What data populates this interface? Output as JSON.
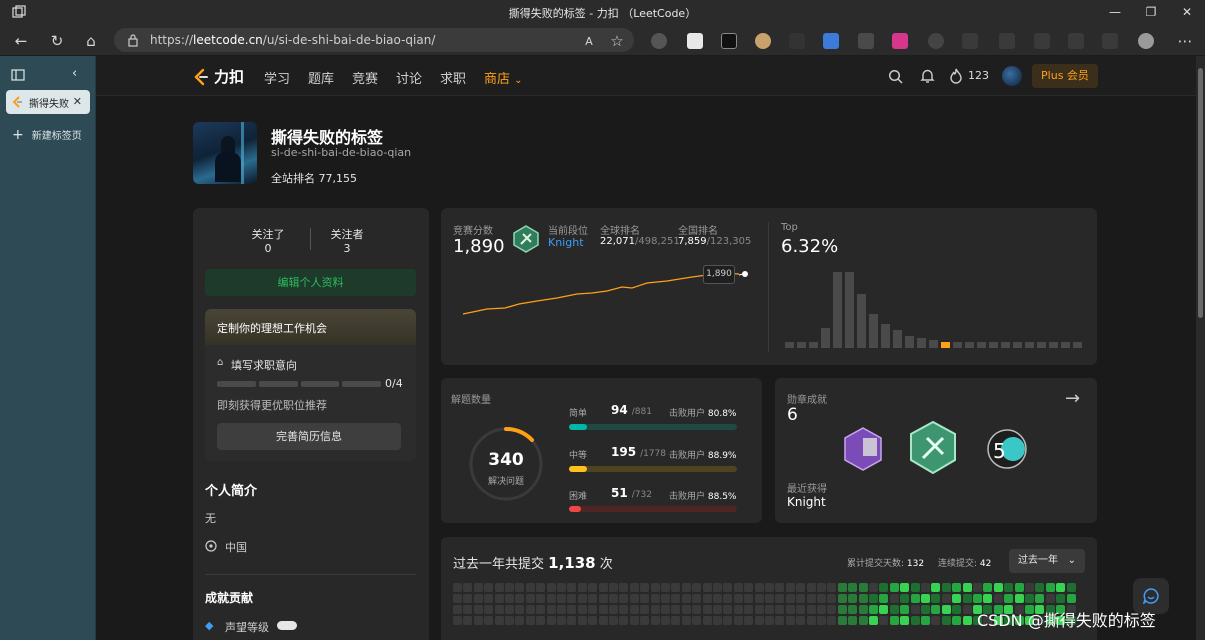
{
  "window": {
    "title": "撕得失败的标签 - 力扣 （LeetCode）",
    "url_scheme": "https://",
    "url_host": "leetcode.cn",
    "url_path": "/u/si-de-shi-bai-de-biao-qian/"
  },
  "sidebar": {
    "tab_label": "撕得失败",
    "new_tab_label": "新建标签页"
  },
  "nav": {
    "logo_text": "力扣",
    "items": [
      "学习",
      "题库",
      "竞赛",
      "讨论",
      "求职"
    ],
    "store_label": "商店",
    "fire_count": "123",
    "plus_label": "Plus 会员"
  },
  "profile": {
    "name": "撕得失败的标签",
    "slug": "si-de-shi-bai-de-biao-qian",
    "rank_label": "全站排名",
    "rank_value": "77,155"
  },
  "left_card": {
    "following_label": "关注了",
    "following_count": "0",
    "followers_label": "关注者",
    "followers_count": "3",
    "edit_profile": "编辑个人资料",
    "job_title": "定制你的理想工作机会",
    "job_fill": "填写求职意向",
    "job_progress": "0/4",
    "job_progress_fraction": 0,
    "job_hint": "即刻获得更优职位推荐",
    "job_button": "完善简历信息",
    "intro_title": "个人简介",
    "intro_text": "无",
    "location": "中国",
    "contrib_title": "成就贡献",
    "reputation_label": "声望等级"
  },
  "contest": {
    "score_label": "竞赛分数",
    "score": "1,890",
    "level_label": "当前段位",
    "level": "Knight",
    "global_label": "全球排名",
    "global_rank": "22,071",
    "global_total": "/498,251",
    "national_label": "全国排名",
    "national_rank": "7,859",
    "national_total": "/123,305",
    "tooltip": "1,890",
    "top_label": "Top",
    "top_value": "6.32%"
  },
  "solved": {
    "title": "解题数量",
    "total": "340",
    "total_label": "解决问题",
    "easy_label": "简单",
    "easy": "94",
    "easy_total": "/881",
    "easy_beat": "80.8%",
    "easy_fraction": 0.107,
    "medium_label": "中等",
    "medium": "195",
    "medium_total": "/1778",
    "medium_beat": "88.9%",
    "medium_fraction": 0.11,
    "hard_label": "困难",
    "hard": "51",
    "hard_total": "/732",
    "hard_beat": "88.5%",
    "hard_fraction": 0.07,
    "beat_label": "击败用户"
  },
  "badges": {
    "title": "勋章成就",
    "count": "6",
    "recent_label": "最近获得",
    "recent": "Knight"
  },
  "submissions": {
    "prefix": "过去一年共提交",
    "count": "1,138",
    "suffix": "次",
    "days_label": "累计提交天数:",
    "days": "132",
    "streak_label": "连续提交:",
    "streak": "42",
    "range": "过去一年"
  },
  "watermark": "CSDN @撕得失败的标签",
  "colors": {
    "accent": "#ffa116",
    "easy": "#00b8a3",
    "medium": "#ffc01e",
    "hard": "#ef4743",
    "knight": "#2cbb5d",
    "level_blue": "#3e9df5"
  }
}
